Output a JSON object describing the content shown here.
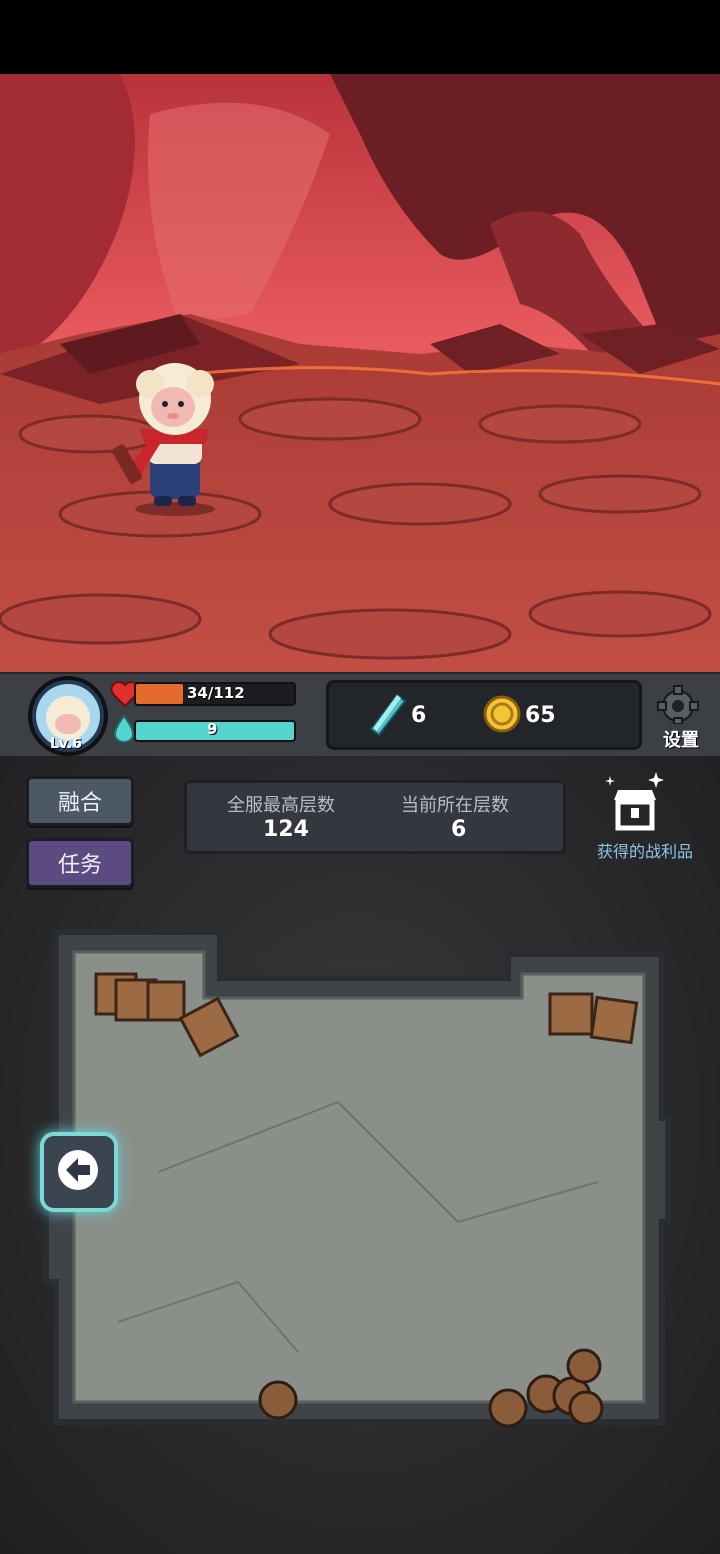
{
  "player": {
    "level": "Lv.6"
  },
  "hp": {
    "text": "34/112",
    "fraction": 0.3
  },
  "mp": {
    "text": "9",
    "fraction": 1.0
  },
  "currency": {
    "gems": "6",
    "coins": "65"
  },
  "settings": {
    "label": "设置"
  },
  "buttons": {
    "fuse": "融合",
    "quest": "任务"
  },
  "floors": {
    "server_max_label": "全服最高层数",
    "server_max_value": "124",
    "current_label": "当前所在层数",
    "current_value": "6"
  },
  "loot": {
    "label": "获得的战利品"
  },
  "icons": {
    "hp": "heart-icon",
    "mp": "mana-drop-icon",
    "gem": "crystal-icon",
    "coin": "coin-icon",
    "settings": "gear-icon",
    "loot": "treasure-chest-icon",
    "back": "back-arrow-icon"
  },
  "colors": {
    "hp_fill": "#e46b2d",
    "mp_fill": "#54d6cf",
    "quest_btn": "#5b4b80",
    "fuse_btn": "#4d5866",
    "loot_text": "#8fc6e8"
  }
}
